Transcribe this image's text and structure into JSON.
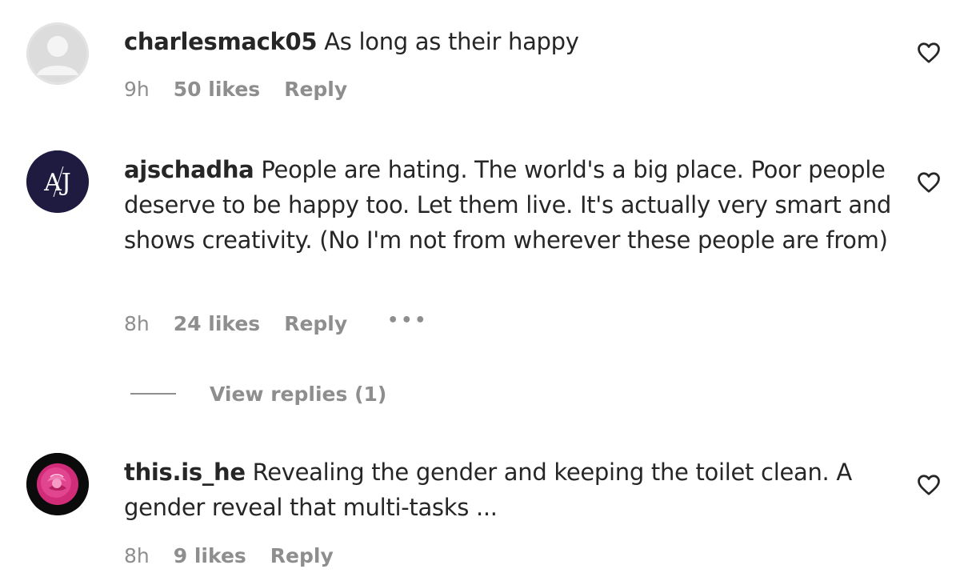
{
  "comments": [
    {
      "username": "charlesmack05",
      "text": "As long as their happy",
      "time": "9h",
      "likes": "50 likes",
      "reply": "Reply",
      "avatar": "default-profile-icon"
    },
    {
      "username": "ajschadha",
      "text": "People are hating. The world's a big place. Poor people deserve to be happy too. Let them live. It's actually very smart and shows creativity. (No I'm not from wherever these people are from)",
      "time": "8h",
      "likes": "24 likes",
      "reply": "Reply",
      "more": "•••",
      "avatar_initials": "AJ",
      "view_replies": "View replies (1)"
    },
    {
      "username": "this.is_he",
      "text": "Revealing the gender and keeping the toilet clean. A gender reveal that multi-tasks ...",
      "time": "8h",
      "likes": "9 likes",
      "reply": "Reply",
      "avatar": "rose-photo"
    }
  ],
  "colors": {
    "text": "#262626",
    "secondary": "#8e8e8e",
    "aj_avatar_bg": "#1f1a40",
    "rose": "#e0408a"
  }
}
